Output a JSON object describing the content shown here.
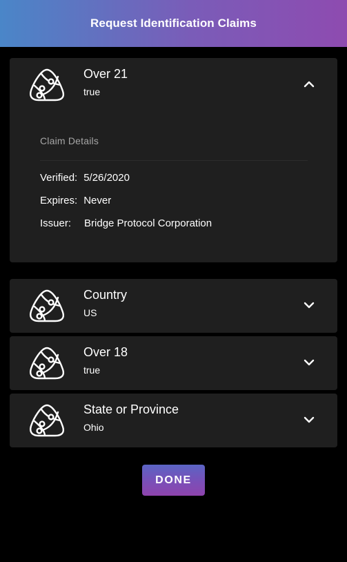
{
  "header": {
    "title": "Request Identification Claims"
  },
  "claims": [
    {
      "name": "Over 21",
      "value": "true",
      "expanded": true,
      "details": {
        "heading": "Claim Details",
        "verified_label": "Verified:",
        "verified_value": "5/26/2020",
        "expires_label": "Expires:",
        "expires_value": "Never",
        "issuer_label": "Issuer:",
        "issuer_value": "Bridge Protocol Corporation"
      }
    },
    {
      "name": "Country",
      "value": "US",
      "expanded": false
    },
    {
      "name": "Over 18",
      "value": "true",
      "expanded": false
    },
    {
      "name": "State or Province",
      "value": "Ohio",
      "expanded": false
    }
  ],
  "icons": {
    "claim": "bridge-protocol-logo-icon",
    "collapse": "chevron-up-icon",
    "expand": "chevron-down-icon"
  },
  "actions": {
    "done_label": "DONE"
  },
  "colors": {
    "background": "#000000",
    "card": "#1f1f1f",
    "header_gradient_start": "#4a86c8",
    "header_gradient_end": "#8e4bb0",
    "muted_text": "#a6a6a6"
  }
}
